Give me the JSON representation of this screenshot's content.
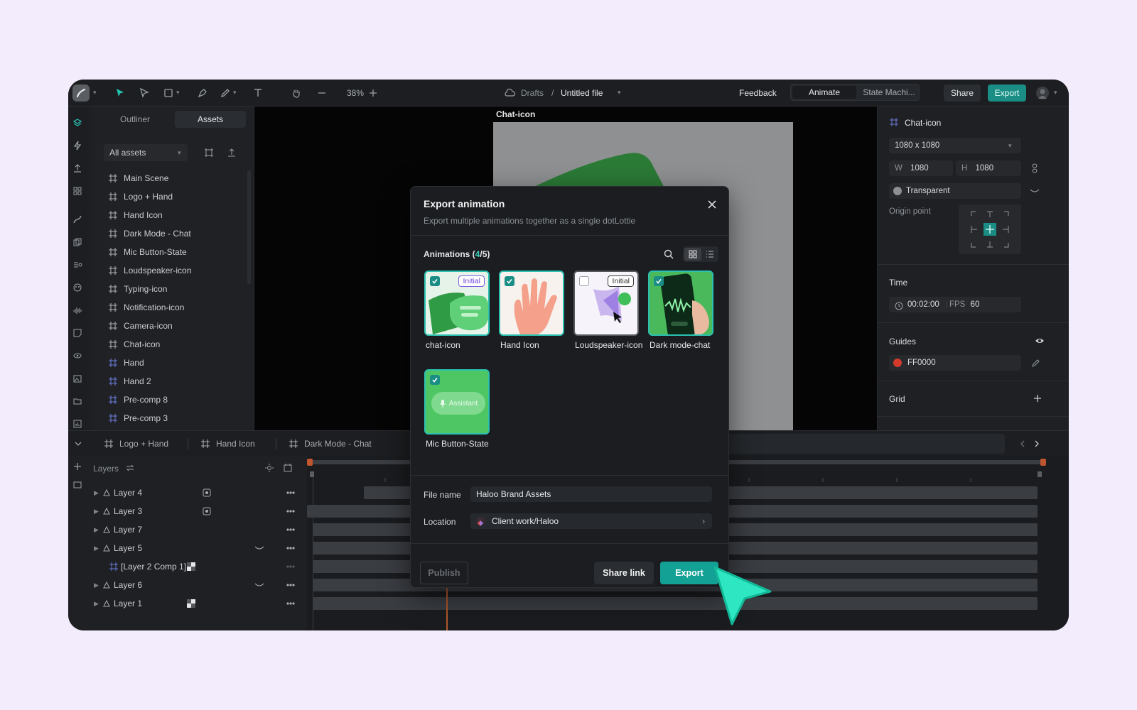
{
  "toolbar": {
    "zoom": "38%",
    "breadcrumb_root": "Drafts",
    "breadcrumb_sep": "/",
    "file_name": "Untitled file",
    "feedback": "Feedback",
    "mode_animate": "Animate",
    "mode_state": "State Machi...",
    "share": "Share",
    "export": "Export"
  },
  "left_panel": {
    "tab_outliner": "Outliner",
    "tab_assets": "Assets",
    "filter": "All assets",
    "assets": [
      "Main Scene",
      "Logo + Hand",
      "Hand Icon",
      "Dark Mode - Chat",
      "Mic Button-State",
      "Loudspeaker-icon",
      "Typing-icon",
      "Notification-icon",
      "Camera-icon",
      "Chat-icon",
      "Hand",
      "Hand 2",
      "Pre-comp 8",
      "Pre-comp 3"
    ]
  },
  "canvas": {
    "artboard_label": "Chat-icon"
  },
  "right_panel": {
    "title": "Chat-icon",
    "size_preset": "1080 x 1080",
    "w_label": "W",
    "w_value": "1080",
    "h_label": "H",
    "h_value": "1080",
    "background": "Transparent",
    "origin_label": "Origin point",
    "time_title": "Time",
    "duration": "00:02:00",
    "fps_label": "FPS",
    "fps_value": "60",
    "guides_title": "Guides",
    "guide_color": "FF0000",
    "grid_title": "Grid"
  },
  "bottom_tabs": [
    "Logo + Hand",
    "Hand Icon",
    "Dark Mode - Chat"
  ],
  "layers": {
    "title": "Layers",
    "items": [
      "Layer 4",
      "Layer 3",
      "Layer 7",
      "Layer 5",
      "[Layer 2 Comp 1]",
      "Layer 6",
      "Layer 1"
    ]
  },
  "modal": {
    "title": "Export animation",
    "subtitle": "Export multiple animations together as a single dotLottie",
    "animations_label": "Animations (",
    "selected_count": "4",
    "total": "/5)",
    "cards": [
      {
        "name": "chat-icon",
        "badge": "Initial"
      },
      {
        "name": "Hand Icon",
        "badge": ""
      },
      {
        "name": "Loudspeaker-icon",
        "badge": "Initial"
      },
      {
        "name": "Dark mode-chat",
        "badge": ""
      },
      {
        "name": "Mic Button-State",
        "badge": "",
        "inner_text": "Assistant"
      }
    ],
    "file_name_label": "File name",
    "file_name_value": "Haloo Brand Assets",
    "location_label": "Location",
    "location_value": "Client work/Haloo",
    "publish": "Publish",
    "share_link": "Share link",
    "export": "Export"
  },
  "colors": {
    "accent": "#14a195",
    "selection": "#2bc1b1",
    "guide": "#d33a2c"
  }
}
